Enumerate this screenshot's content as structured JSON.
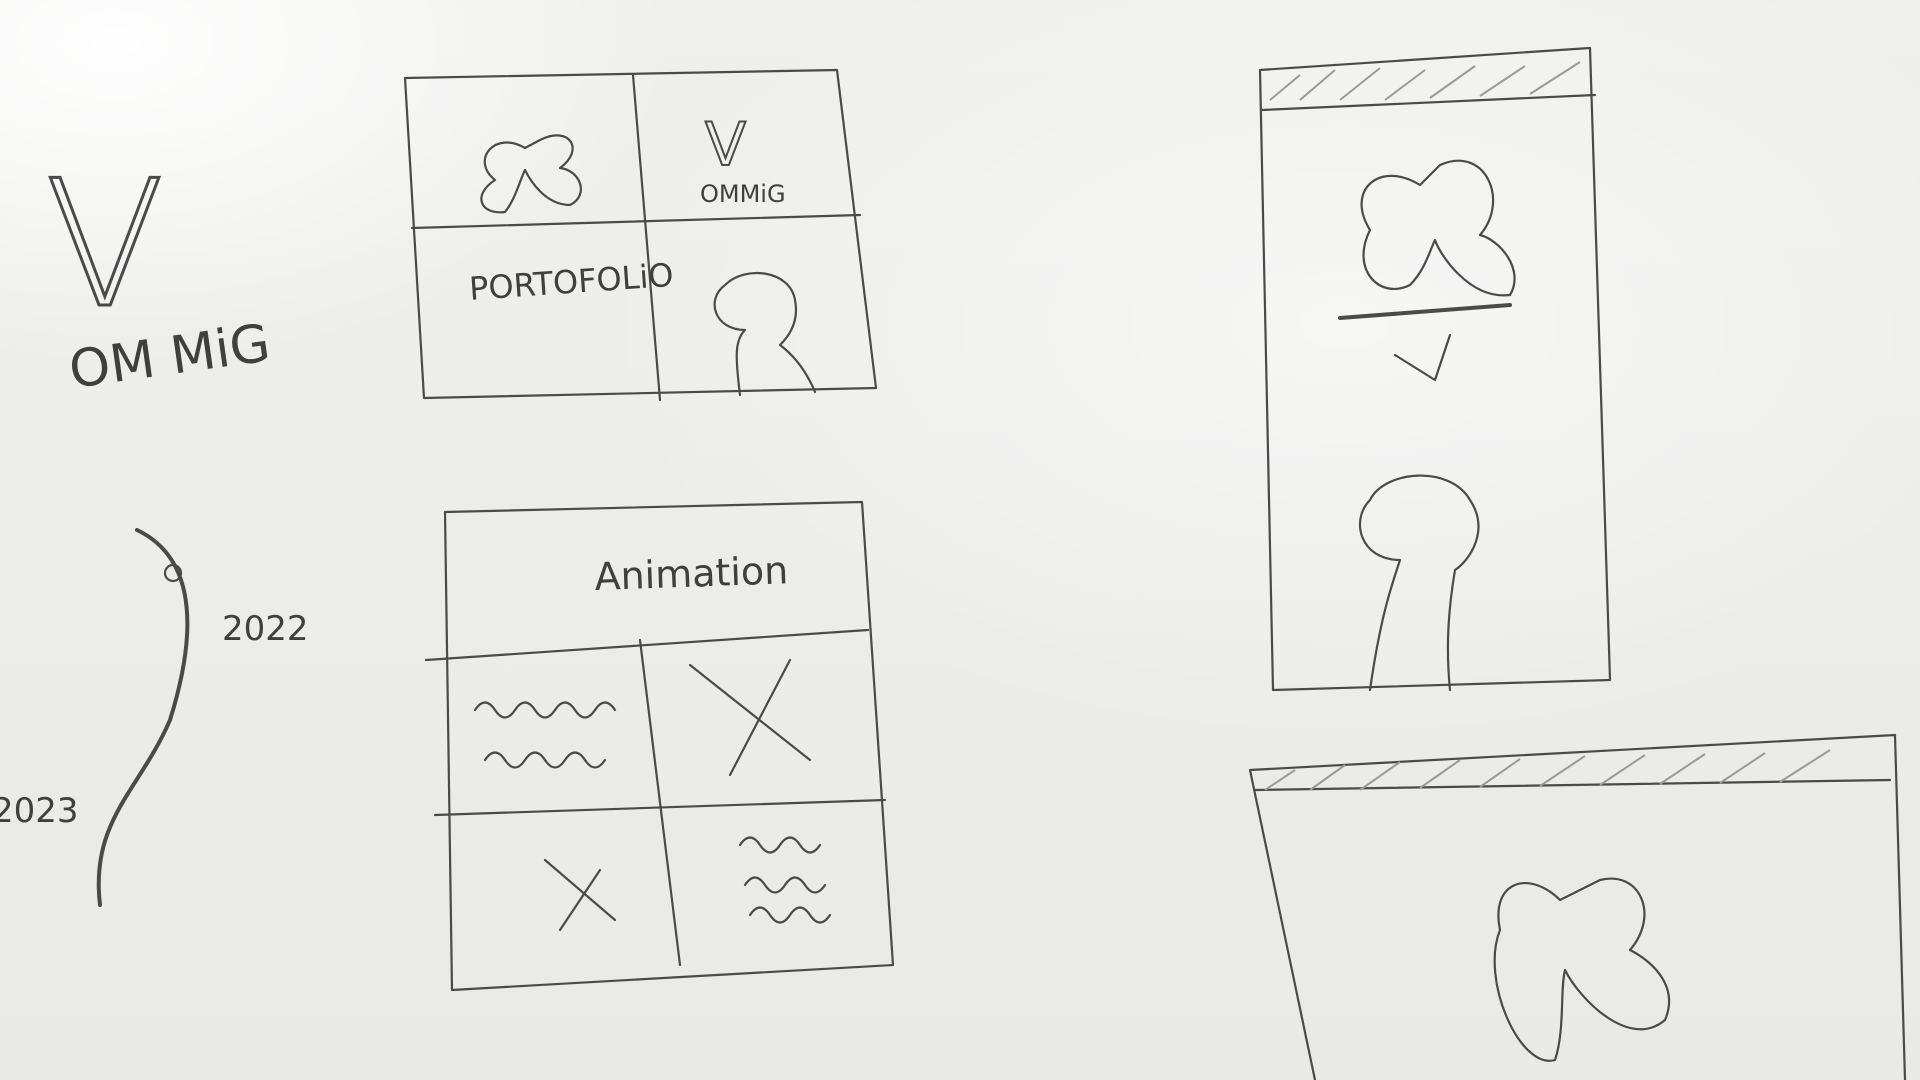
{
  "logo_letter": "V",
  "logo_caption": "OM MiG",
  "tile_about_caption": "OMMiG",
  "tile_portfolio_label": "PORTOFOLiO",
  "animation_header": "Animation",
  "timeline": {
    "year_top": "2022",
    "year_bottom": "2023"
  }
}
